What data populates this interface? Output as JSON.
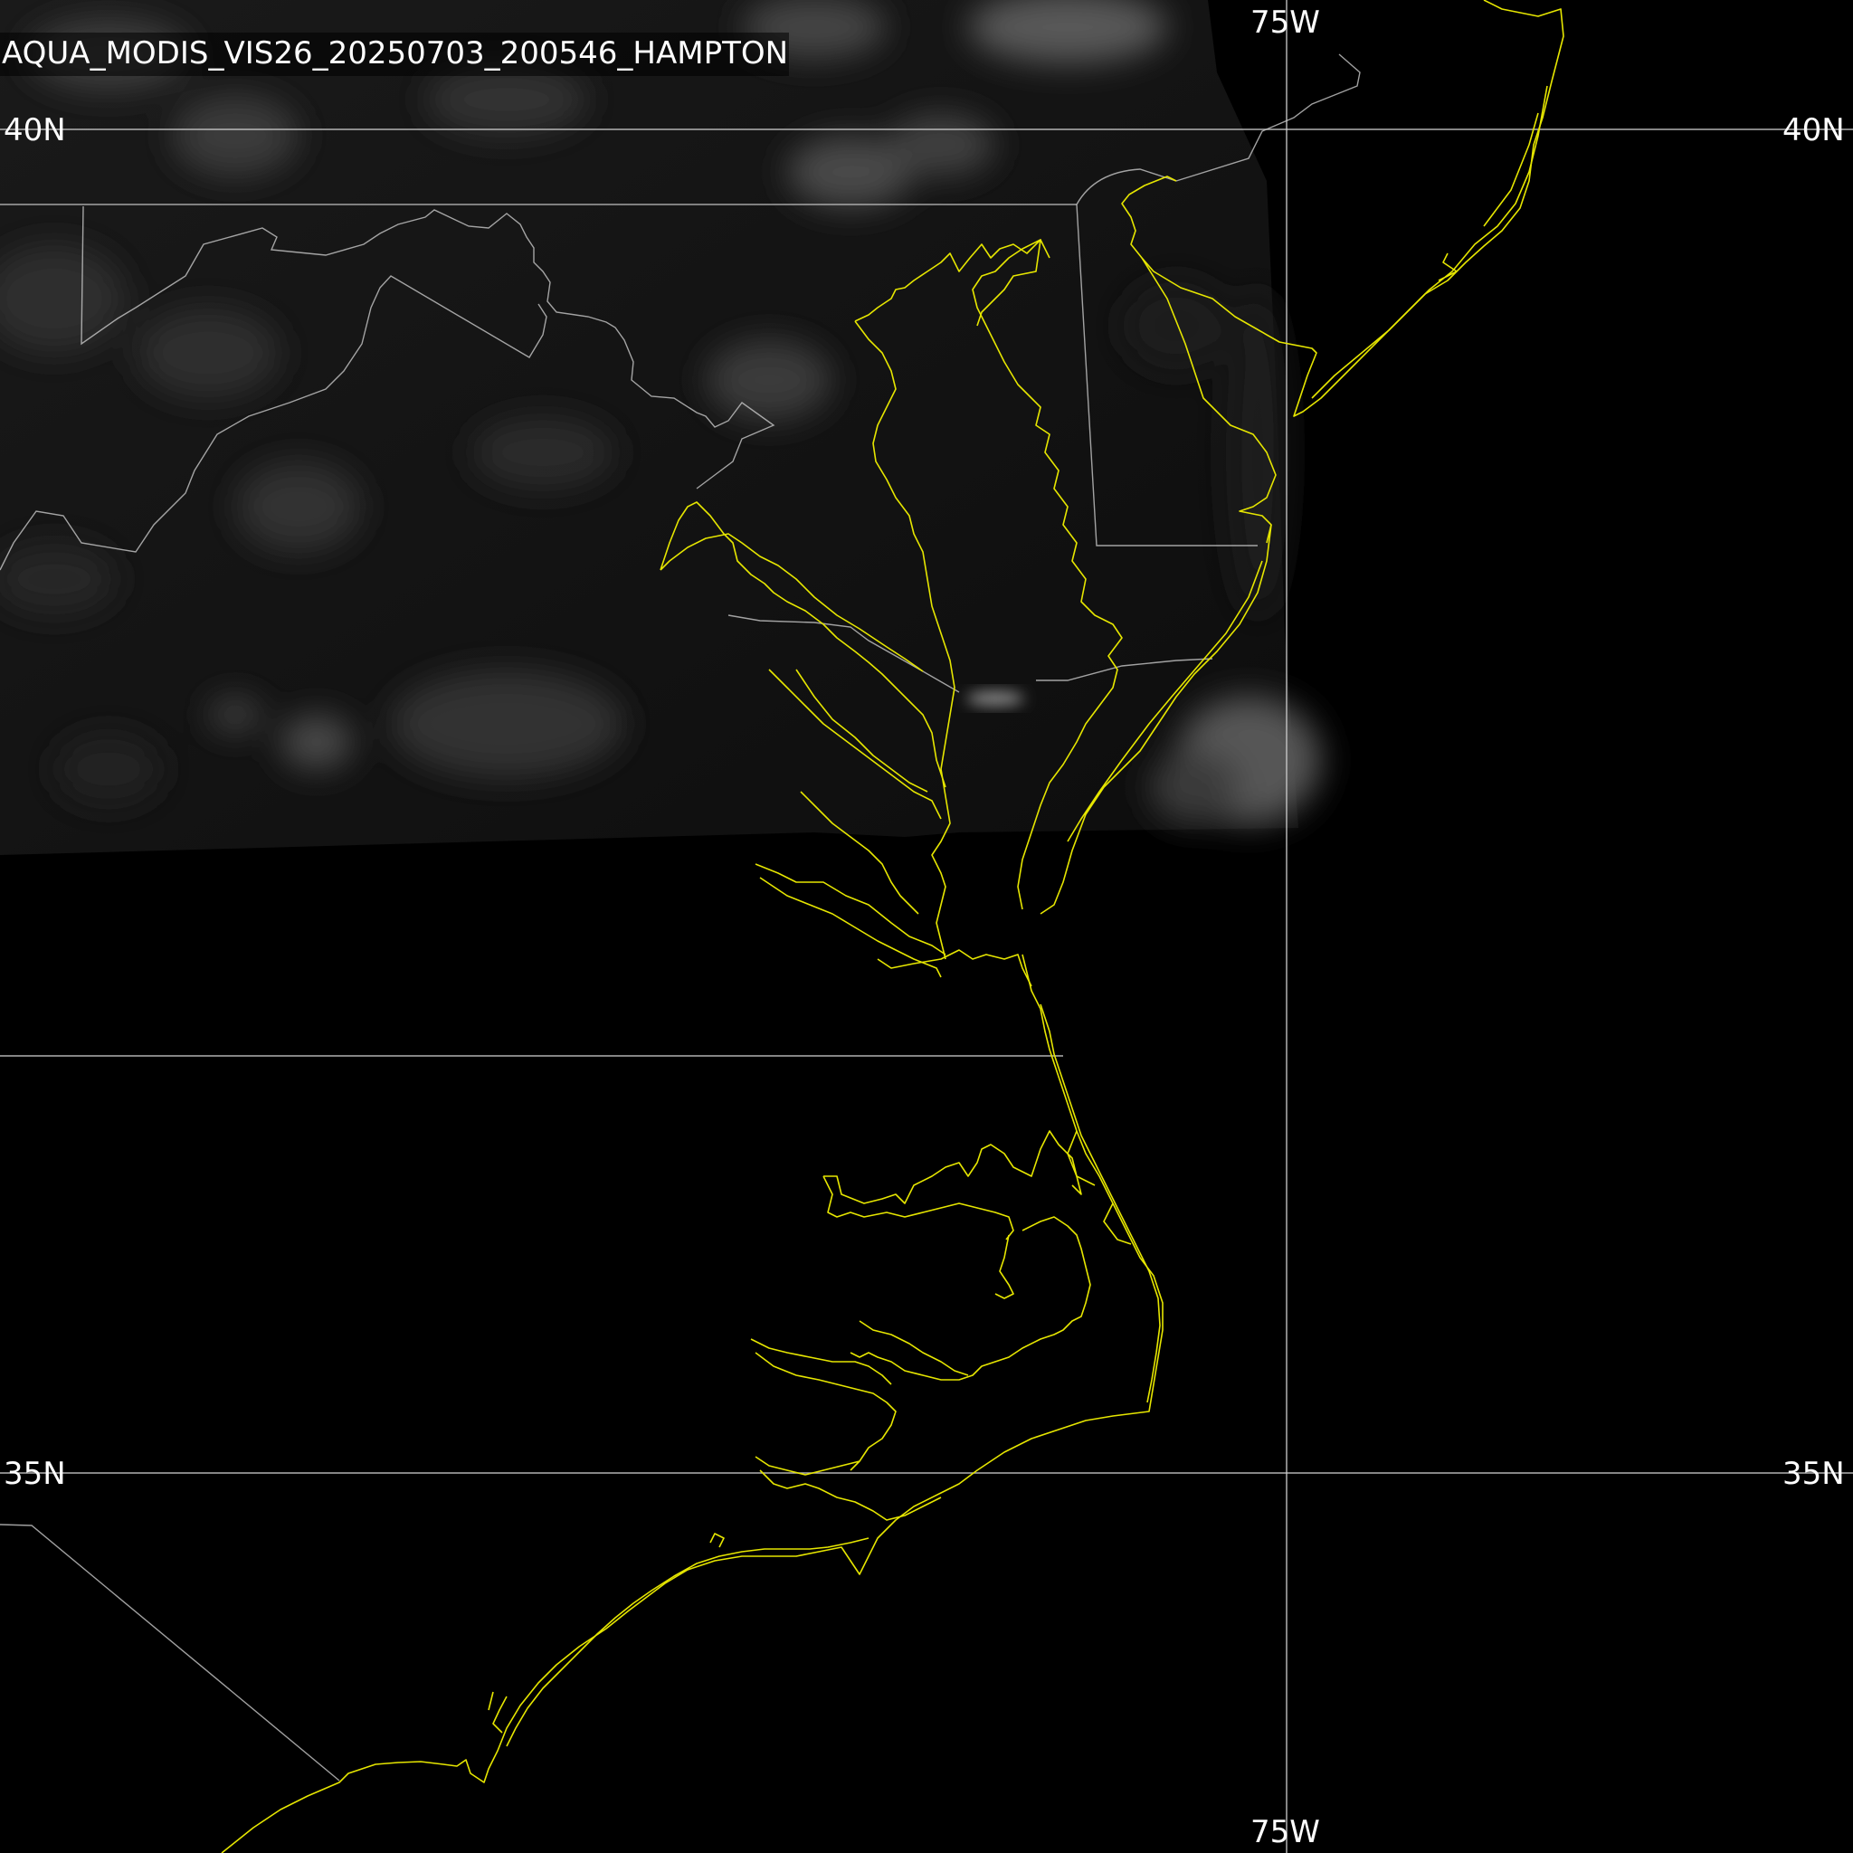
{
  "image": {
    "title": "AQUA_MODIS_VIS26_20250703_200546_HAMPTON"
  },
  "colors": {
    "background": "#000000",
    "gridlines": "#d0d0d0",
    "borders": "#c8c8c8",
    "coastline": "#e6e600",
    "labels": "#ffffff"
  },
  "graticule": {
    "lat_labels": {
      "north_left": "40N",
      "north_right": "40N",
      "south_left": "35N",
      "south_right": "35N"
    },
    "lon_labels": {
      "top": "75W",
      "bottom": "75W"
    }
  }
}
